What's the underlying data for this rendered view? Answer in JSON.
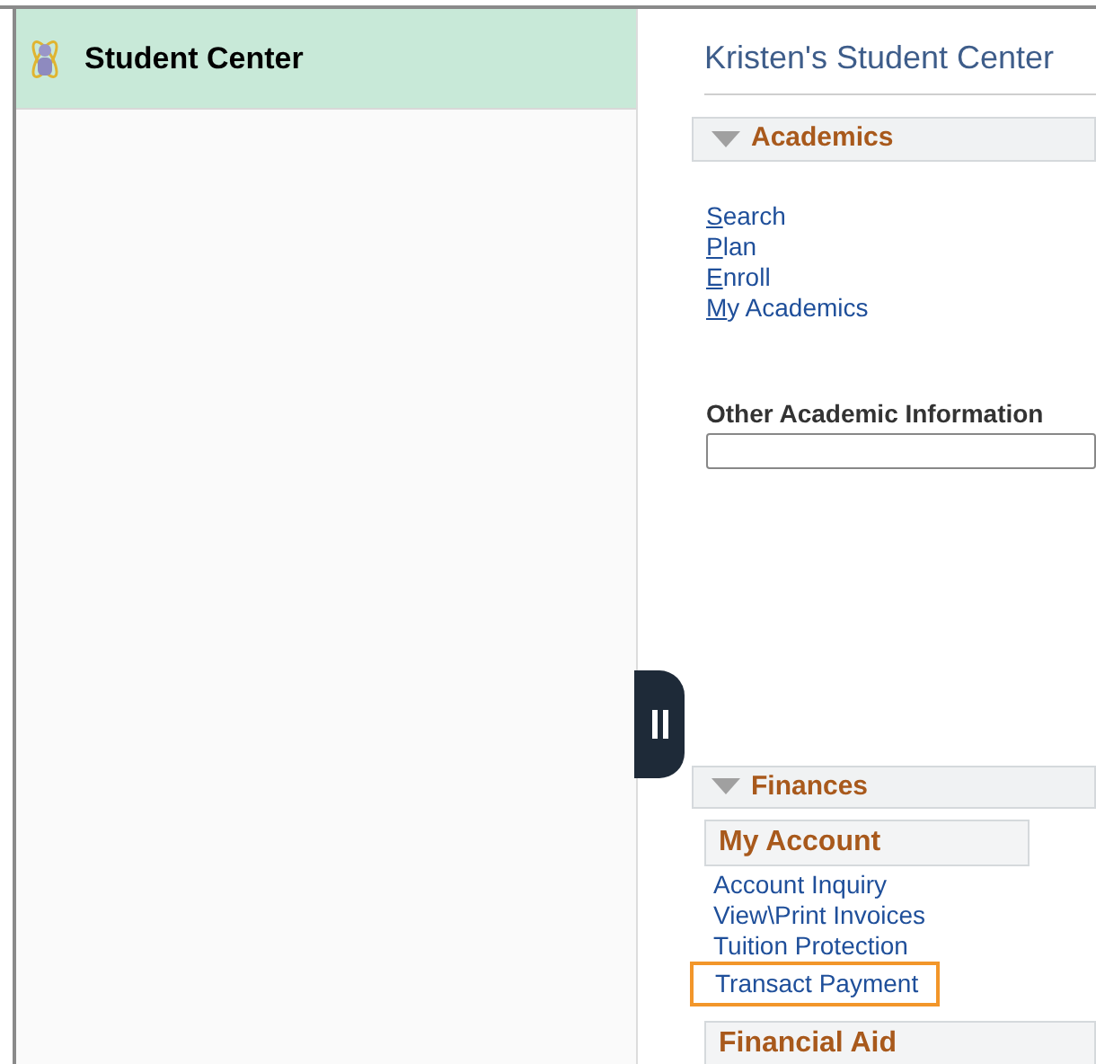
{
  "sidebar": {
    "title": "Student Center"
  },
  "page_title": "Kristen's Student Center",
  "sections": [
    {
      "title": "Academics",
      "expanded": true,
      "links": [
        {
          "label": "Search"
        },
        {
          "label": "Plan"
        },
        {
          "label": "Enroll"
        },
        {
          "label": "My Academics"
        }
      ],
      "dropdown_label": "Other Academic Information"
    },
    {
      "title": "Finances",
      "expanded": true,
      "subsections": [
        {
          "title": "My Account",
          "links": [
            {
              "label": "Account Inquiry",
              "highlighted": false
            },
            {
              "label": "View\\Print Invoices",
              "highlighted": false
            },
            {
              "label": "Tuition Protection",
              "highlighted": false
            },
            {
              "label": "Transact Payment",
              "highlighted": true
            }
          ]
        },
        {
          "title": "Financial Aid"
        }
      ]
    }
  ]
}
